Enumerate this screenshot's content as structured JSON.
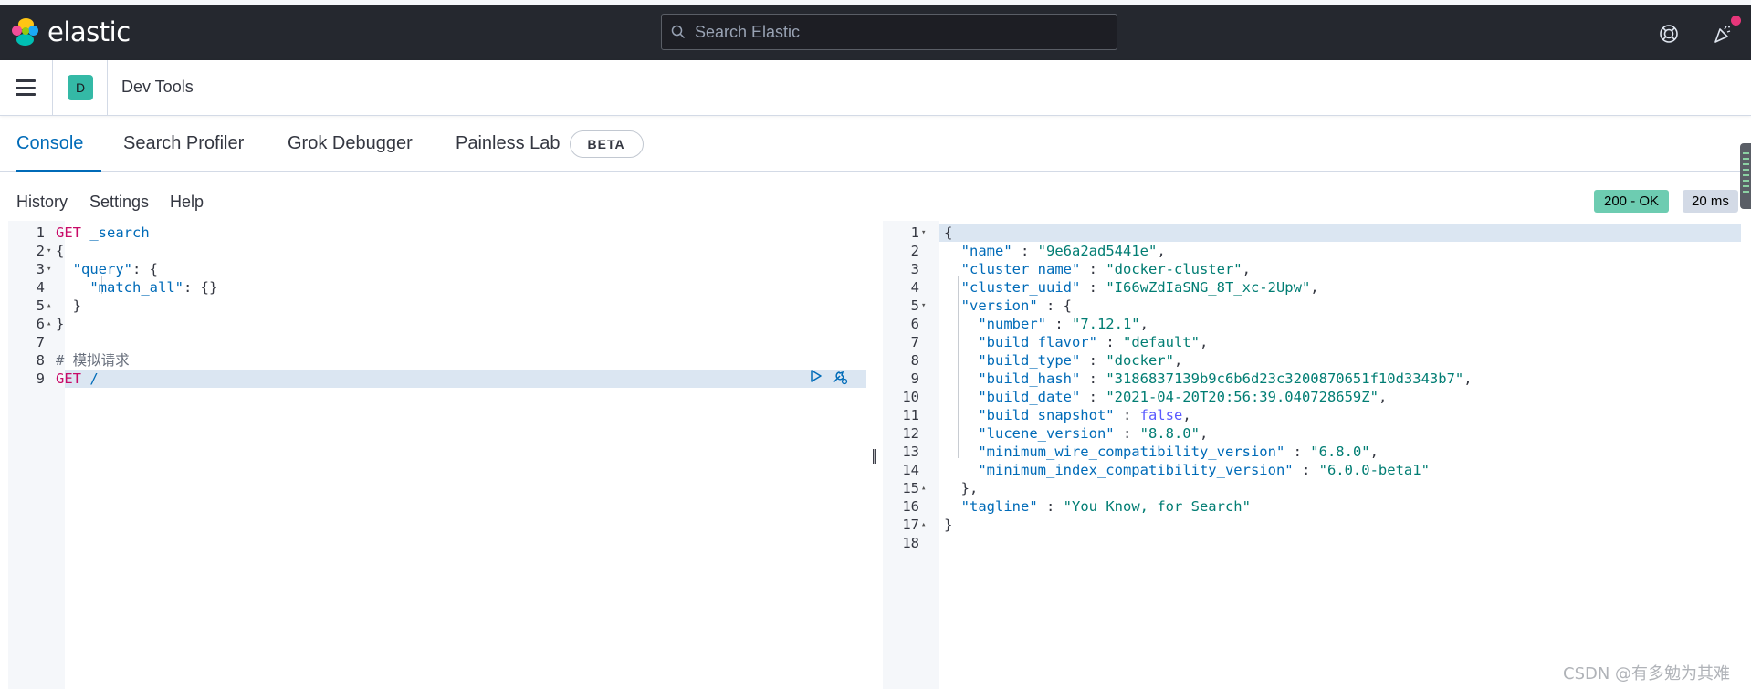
{
  "header": {
    "logo_text": "elastic",
    "search_placeholder": "Search Elastic",
    "help_icon": "help-lifebuoy-icon",
    "news_icon": "newsfeed-party-icon"
  },
  "nav": {
    "space_initial": "D",
    "app_title": "Dev Tools"
  },
  "tabs": [
    {
      "label": "Console"
    },
    {
      "label": "Search Profiler"
    },
    {
      "label": "Grok Debugger"
    },
    {
      "label": "Painless Lab",
      "badge": "BETA"
    }
  ],
  "toolbar": {
    "history": "History",
    "settings": "Settings",
    "help": "Help",
    "status": "200 - OK",
    "time": "20 ms"
  },
  "request_editor": {
    "lines": [
      [
        {
          "t": "GET",
          "c": "m"
        },
        {
          "t": " _search",
          "c": "k"
        }
      ],
      [
        {
          "t": "{",
          "c": "p"
        }
      ],
      [
        {
          "t": "  ",
          "c": "p"
        },
        {
          "t": "\"query\"",
          "c": "k"
        },
        {
          "t": ": {",
          "c": "p"
        }
      ],
      [
        {
          "t": "    ",
          "c": "p"
        },
        {
          "t": "\"match_all\"",
          "c": "k"
        },
        {
          "t": ": {}",
          "c": "p"
        }
      ],
      [
        {
          "t": "  }",
          "c": "p"
        }
      ],
      [
        {
          "t": "}",
          "c": "p"
        }
      ],
      [],
      [
        {
          "t": "# 模拟请求",
          "c": "c"
        }
      ],
      [
        {
          "t": "GET",
          "c": "m"
        },
        {
          "t": " /",
          "c": "k"
        }
      ]
    ],
    "fold_lines": [
      2,
      3,
      5,
      6
    ],
    "highlight_line": 9
  },
  "response_editor": {
    "lines": [
      [
        {
          "t": "{",
          "c": "p"
        }
      ],
      [
        {
          "t": "  ",
          "c": "p"
        },
        {
          "t": "\"name\"",
          "c": "k"
        },
        {
          "t": " : ",
          "c": "p"
        },
        {
          "t": "\"9e6a2ad5441e\"",
          "c": "s"
        },
        {
          "t": ",",
          "c": "p"
        }
      ],
      [
        {
          "t": "  ",
          "c": "p"
        },
        {
          "t": "\"cluster_name\"",
          "c": "k"
        },
        {
          "t": " : ",
          "c": "p"
        },
        {
          "t": "\"docker-cluster\"",
          "c": "s"
        },
        {
          "t": ",",
          "c": "p"
        }
      ],
      [
        {
          "t": "  ",
          "c": "p"
        },
        {
          "t": "\"cluster_uuid\"",
          "c": "k"
        },
        {
          "t": " : ",
          "c": "p"
        },
        {
          "t": "\"I66wZdIaSNG_8T_xc-2Upw\"",
          "c": "s"
        },
        {
          "t": ",",
          "c": "p"
        }
      ],
      [
        {
          "t": "  ",
          "c": "p"
        },
        {
          "t": "\"version\"",
          "c": "k"
        },
        {
          "t": " : {",
          "c": "p"
        }
      ],
      [
        {
          "t": "    ",
          "c": "p"
        },
        {
          "t": "\"number\"",
          "c": "k"
        },
        {
          "t": " : ",
          "c": "p"
        },
        {
          "t": "\"7.12.1\"",
          "c": "s"
        },
        {
          "t": ",",
          "c": "p"
        }
      ],
      [
        {
          "t": "    ",
          "c": "p"
        },
        {
          "t": "\"build_flavor\"",
          "c": "k"
        },
        {
          "t": " : ",
          "c": "p"
        },
        {
          "t": "\"default\"",
          "c": "s"
        },
        {
          "t": ",",
          "c": "p"
        }
      ],
      [
        {
          "t": "    ",
          "c": "p"
        },
        {
          "t": "\"build_type\"",
          "c": "k"
        },
        {
          "t": " : ",
          "c": "p"
        },
        {
          "t": "\"docker\"",
          "c": "s"
        },
        {
          "t": ",",
          "c": "p"
        }
      ],
      [
        {
          "t": "    ",
          "c": "p"
        },
        {
          "t": "\"build_hash\"",
          "c": "k"
        },
        {
          "t": " : ",
          "c": "p"
        },
        {
          "t": "\"3186837139b9c6b6d23c3200870651f10d3343b7\"",
          "c": "s"
        },
        {
          "t": ",",
          "c": "p"
        }
      ],
      [
        {
          "t": "    ",
          "c": "p"
        },
        {
          "t": "\"build_date\"",
          "c": "k"
        },
        {
          "t": " : ",
          "c": "p"
        },
        {
          "t": "\"2021-04-20T20:56:39.040728659Z\"",
          "c": "s"
        },
        {
          "t": ",",
          "c": "p"
        }
      ],
      [
        {
          "t": "    ",
          "c": "p"
        },
        {
          "t": "\"build_snapshot\"",
          "c": "k"
        },
        {
          "t": " : ",
          "c": "p"
        },
        {
          "t": "false",
          "c": "b"
        },
        {
          "t": ",",
          "c": "p"
        }
      ],
      [
        {
          "t": "    ",
          "c": "p"
        },
        {
          "t": "\"lucene_version\"",
          "c": "k"
        },
        {
          "t": " : ",
          "c": "p"
        },
        {
          "t": "\"8.8.0\"",
          "c": "s"
        },
        {
          "t": ",",
          "c": "p"
        }
      ],
      [
        {
          "t": "    ",
          "c": "p"
        },
        {
          "t": "\"minimum_wire_compatibility_version\"",
          "c": "k"
        },
        {
          "t": " : ",
          "c": "p"
        },
        {
          "t": "\"6.8.0\"",
          "c": "s"
        },
        {
          "t": ",",
          "c": "p"
        }
      ],
      [
        {
          "t": "    ",
          "c": "p"
        },
        {
          "t": "\"minimum_index_compatibility_version\"",
          "c": "k"
        },
        {
          "t": " : ",
          "c": "p"
        },
        {
          "t": "\"6.0.0-beta1\"",
          "c": "s"
        }
      ],
      [
        {
          "t": "  },",
          "c": "p"
        }
      ],
      [
        {
          "t": "  ",
          "c": "p"
        },
        {
          "t": "\"tagline\"",
          "c": "k"
        },
        {
          "t": " : ",
          "c": "p"
        },
        {
          "t": "\"You Know, for Search\"",
          "c": "s"
        }
      ],
      [
        {
          "t": "}",
          "c": "p"
        }
      ],
      []
    ],
    "fold_lines": [
      1,
      5,
      15,
      17
    ],
    "highlight_line": 1
  },
  "watermark": "CSDN @有多勉为其难",
  "colors": {
    "header_bg": "#25282f",
    "accent": "#006bb8",
    "status_ok": "#6dccb1",
    "method": "#c80a68",
    "string": "#017d73"
  }
}
